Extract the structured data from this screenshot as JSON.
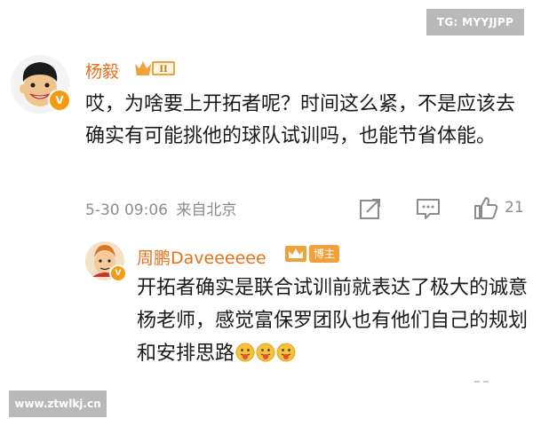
{
  "watermarks": {
    "top": "TG: MYYJJPP",
    "bottom": "www.ztwlkj.cn"
  },
  "main_comment": {
    "username": "杨毅",
    "level_badge": "II",
    "text": "哎，为啥要上开拓者呢？时间这么紧，不是应该去确实有可能挑他的球队试训吗，也能节省体能。",
    "timestamp": "5-30 09:06",
    "location": "来自北京",
    "like_count": "21",
    "icons": {
      "avatar": "avatar-cartoon-icon",
      "verified": "verified-v-icon",
      "share": "share-icon",
      "comment": "comment-icon",
      "like": "thumbs-up-icon"
    }
  },
  "reply": {
    "username": "周鹏Daveeeeee",
    "blogger_badge": "博主",
    "text": "开拓者确实是联合试训前就表达了极大的诚意杨老师，感觉富保罗团队也有他们自己的规划和安排思路",
    "emojis": [
      "tongue-out-emoji",
      "tongue-out-emoji",
      "tongue-out-emoji"
    ]
  },
  "colors": {
    "username": "#e8701a",
    "badge_gold": "#f2a13a",
    "meta_gray": "#8c8c8c",
    "verified": "#f39c12",
    "watermark_bg": "#b9b9b9"
  }
}
